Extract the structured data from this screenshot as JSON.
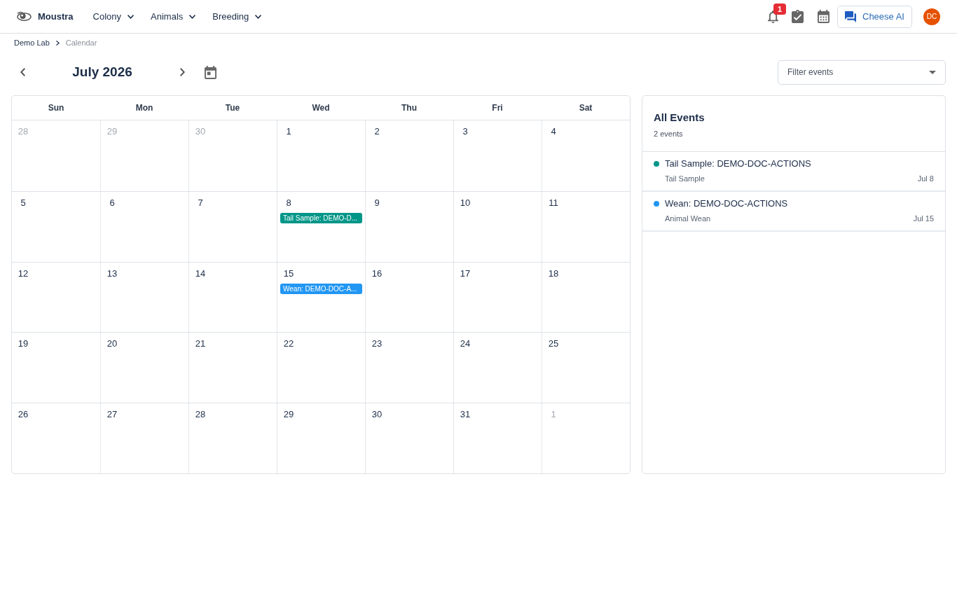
{
  "header": {
    "brand": "Moustra",
    "nav": [
      {
        "label": "Colony"
      },
      {
        "label": "Animals"
      },
      {
        "label": "Breeding"
      }
    ],
    "notification_count": "1",
    "ai_button": "Cheese AI",
    "avatar": "DC"
  },
  "breadcrumb": [
    {
      "label": "Demo Lab",
      "current": false
    },
    {
      "label": "Calendar",
      "current": true
    }
  ],
  "calendar": {
    "month": "July 2026",
    "filter": {
      "placeholder": "Filter events"
    },
    "weekdays": [
      "Sun",
      "Mon",
      "Tue",
      "Wed",
      "Thu",
      "Fri",
      "Sat"
    ],
    "weeks": [
      [
        {
          "day": "28",
          "outside": true
        },
        {
          "day": "29",
          "outside": true
        },
        {
          "day": "30",
          "outside": true
        },
        {
          "day": "1",
          "outside": false
        },
        {
          "day": "2",
          "outside": false
        },
        {
          "day": "3",
          "outside": false
        },
        {
          "day": "4",
          "outside": false
        }
      ],
      [
        {
          "day": "5",
          "outside": false
        },
        {
          "day": "6",
          "outside": false
        },
        {
          "day": "7",
          "outside": false
        },
        {
          "day": "8",
          "outside": false,
          "events": [
            {
              "label": "Tail Sample: DEMO-D...",
              "color": "#009688"
            }
          ]
        },
        {
          "day": "9",
          "outside": false
        },
        {
          "day": "10",
          "outside": false
        },
        {
          "day": "11",
          "outside": false
        }
      ],
      [
        {
          "day": "12",
          "outside": false
        },
        {
          "day": "13",
          "outside": false
        },
        {
          "day": "14",
          "outside": false
        },
        {
          "day": "15",
          "outside": false,
          "events": [
            {
              "label": "Wean: DEMO-DOC-A...",
              "color": "#2196f3"
            }
          ]
        },
        {
          "day": "16",
          "outside": false
        },
        {
          "day": "17",
          "outside": false
        },
        {
          "day": "18",
          "outside": false
        }
      ],
      [
        {
          "day": "19",
          "outside": false
        },
        {
          "day": "20",
          "outside": false
        },
        {
          "day": "21",
          "outside": false
        },
        {
          "day": "22",
          "outside": false
        },
        {
          "day": "23",
          "outside": false
        },
        {
          "day": "24",
          "outside": false
        },
        {
          "day": "25",
          "outside": false
        }
      ],
      [
        {
          "day": "26",
          "outside": false
        },
        {
          "day": "27",
          "outside": false
        },
        {
          "day": "28",
          "outside": false
        },
        {
          "day": "29",
          "outside": false
        },
        {
          "day": "30",
          "outside": false
        },
        {
          "day": "31",
          "outside": false
        },
        {
          "day": "1",
          "outside": true
        }
      ]
    ]
  },
  "events_panel": {
    "title": "All Events",
    "count": "2 events",
    "events": [
      {
        "title": "Tail Sample: DEMO-DOC-ACTIONS",
        "type": "Tail Sample",
        "date": "Jul 8",
        "color": "#009688"
      },
      {
        "title": "Wean: DEMO-DOC-ACTIONS",
        "type": "Animal Wean",
        "date": "Jul 15",
        "color": "#2196f3"
      }
    ]
  }
}
